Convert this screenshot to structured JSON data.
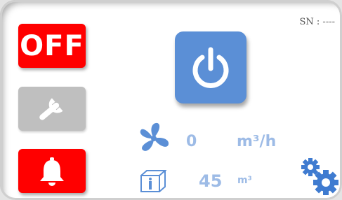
{
  "header": {
    "serial": "SN : ----"
  },
  "buttons": {
    "off_label": "OFF"
  },
  "readings": {
    "airflow": {
      "value": "0",
      "unit": "m³/h"
    },
    "volume": {
      "value": "45",
      "unit": "m³"
    }
  },
  "icons": {
    "wrench": "wrench-icon",
    "alarm": "bell-icon",
    "power": "power-icon",
    "fan": "fan-icon",
    "room": "cube-person-icon",
    "settings": "gears-icon"
  },
  "colors": {
    "alert_red": "#ff0000",
    "accent_blue": "#5b8fd6",
    "value_blue": "#9dbbe6",
    "disabled_gray": "#bfbfbf"
  }
}
